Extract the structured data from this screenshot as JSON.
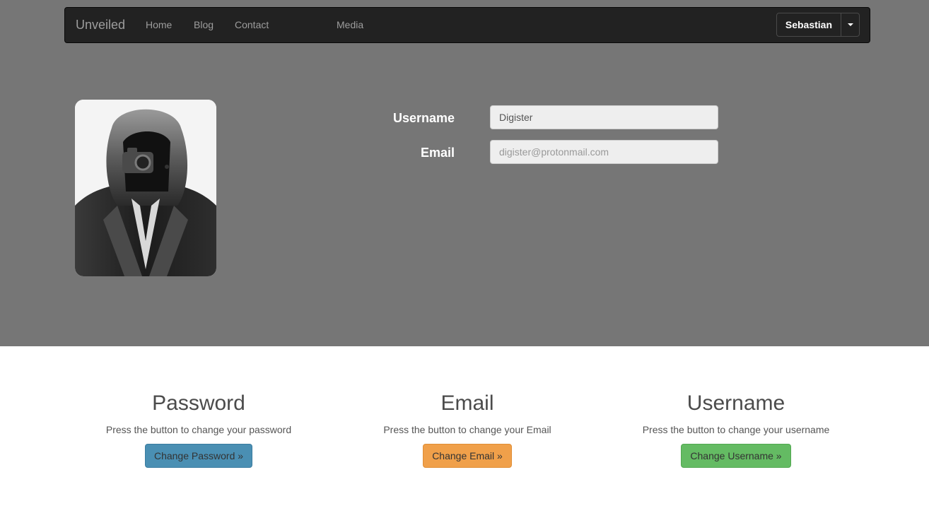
{
  "nav": {
    "brand": "Unveiled",
    "links": [
      "Home",
      "Blog",
      "Contact",
      "Media"
    ],
    "user": "Sebastian",
    "user_caret_icon": "caret-down-icon"
  },
  "profile": {
    "avatar_icon": "hooded-figure-avatar",
    "username_label": "Username",
    "username_value": "Digister",
    "email_label": "Email",
    "email_placeholder": "digister@protonmail.com"
  },
  "actions": [
    {
      "title": "Password",
      "text": "Press the button to change your password",
      "button": "Change Password »",
      "color": "#4a8fb3"
    },
    {
      "title": "Email",
      "text": "Press the button to change your Email",
      "button": "Change Email »",
      "color": "#f0a04a"
    },
    {
      "title": "Username",
      "text": "Press the button to change your username",
      "button": "Change Username »",
      "color": "#64bb63"
    }
  ],
  "colors": {
    "hero_bg": "#767676",
    "navbar_bg": "#222222"
  }
}
